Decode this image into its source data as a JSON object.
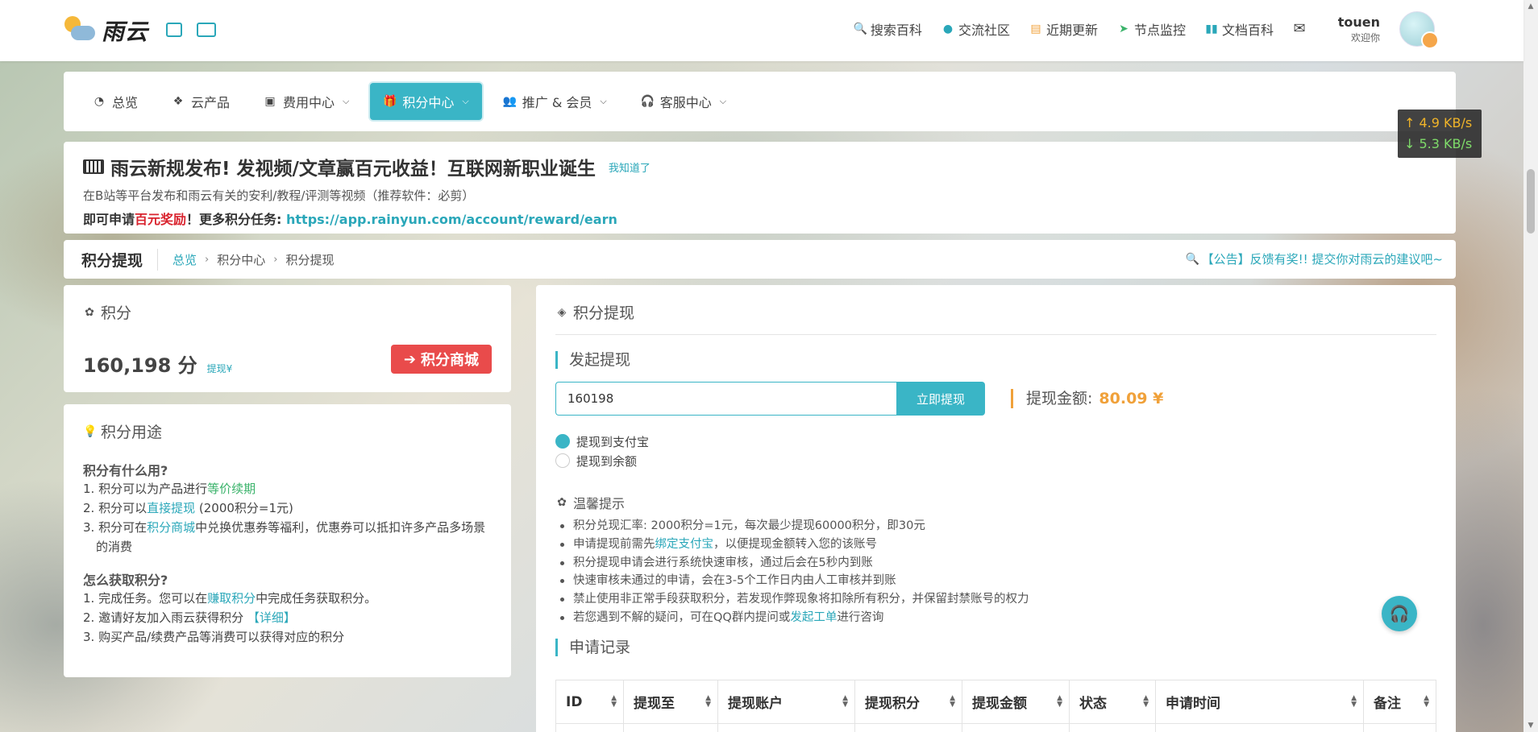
{
  "brand": {
    "name": "雨云"
  },
  "topnav": {
    "items": [
      {
        "icon": "search-icon",
        "label": "搜索百科"
      },
      {
        "icon": "bell-icon",
        "label": "交流社区"
      },
      {
        "icon": "news-icon",
        "label": "近期更新"
      },
      {
        "icon": "send-icon",
        "label": "节点监控"
      },
      {
        "icon": "book-icon",
        "label": "文档百科"
      }
    ],
    "user": {
      "name": "touen",
      "welcome": "欢迎你"
    }
  },
  "menu": {
    "items": [
      {
        "icon": "dashboard-icon",
        "label": "总览",
        "dropdown": false
      },
      {
        "icon": "cubes-icon",
        "label": "云产品",
        "dropdown": false
      },
      {
        "icon": "money-icon",
        "label": "费用中心",
        "dropdown": true
      },
      {
        "icon": "gift-icon",
        "label": "积分中心",
        "dropdown": true,
        "active": true
      },
      {
        "icon": "users-icon",
        "label": "推广 & 会员",
        "dropdown": true
      },
      {
        "icon": "headset-icon",
        "label": "客服中心",
        "dropdown": true
      }
    ]
  },
  "netspeed": {
    "up": "↑ 4.9 KB/s",
    "down": "↓ 5.3 KB/s"
  },
  "announcement": {
    "title": "雨云新规发布! 发视频/文章赢百元收益！互联网新职业诞生",
    "dismiss": "我知道了",
    "line1": "在B站等平台发布和雨云有关的安利/教程/评测等视频（推荐软件：必剪）",
    "line2_prefix": "即可申请",
    "line2_red": "百元奖励",
    "line2_mid": "！更多积分任务: ",
    "line2_link": "https://app.rainyun.com/account/reward/earn"
  },
  "breadcrumb": {
    "title": "积分提现",
    "items": [
      "总览",
      "积分中心",
      "积分提现"
    ],
    "notice": "【公告】反馈有奖!! 提交你对雨云的建议吧~"
  },
  "points": {
    "head": "积分",
    "value": "160,198 分",
    "sub": "提现¥",
    "shop_button": "积分商城"
  },
  "usage": {
    "head": "积分用途",
    "q1": "积分有什么用?",
    "a1": [
      {
        "pre": "1. 积分可以为产品进行",
        "hl": "等价续期",
        "post": ""
      },
      {
        "pre": "2. 积分可以",
        "hl": "直接提现",
        "post": " (2000积分=1元)"
      },
      {
        "pre": "3. 积分可在",
        "hl": "积分商城",
        "post": "中兑换优惠券等福利，优惠券可以抵扣许多产品多场景的消费"
      }
    ],
    "q2": "怎么获取积分?",
    "a2": [
      {
        "pre": "1. 完成任务。您可以在",
        "hl": "赚取积分",
        "post": "中完成任务获取积分。"
      },
      {
        "pre": "2. 邀请好友加入雨云获得积分 ",
        "hl": "【详细】",
        "post": ""
      },
      {
        "pre": "3. 购买产品/续费产品等消费可以获得对应的积分",
        "hl": "",
        "post": ""
      }
    ]
  },
  "withdraw": {
    "head": "积分提现",
    "section": "发起提现",
    "input_value": "160198",
    "button": "立即提现",
    "amount_label": "提现金额:",
    "amount_value": "80.09 ¥",
    "options": [
      "提现到支付宝",
      "提现到余额"
    ],
    "selected_option": 0,
    "tips_head": "温馨提示",
    "tips": [
      {
        "pre": "积分兑现汇率: 2000积分=1元，每次最少提现60000积分，即30元",
        "hl": "",
        "post": ""
      },
      {
        "pre": "申请提现前需先",
        "hl": "绑定支付宝",
        "post": "，以便提现金额转入您的该账号"
      },
      {
        "pre": "积分提现申请会进行系统快速审核，通过后会在5秒内到账",
        "hl": "",
        "post": ""
      },
      {
        "pre": "快速审核未通过的申请，会在3-5个工作日内由人工审核并到账",
        "hl": "",
        "post": ""
      },
      {
        "pre": "禁止使用非正常手段获取积分，若发现作弊现象将扣除所有积分，并保留封禁账号的权力",
        "hl": "",
        "post": ""
      },
      {
        "pre": "若您遇到不解的疑问，可在QQ群内提问或",
        "hl": "发起工单",
        "post": "进行咨询"
      }
    ],
    "records_title": "申请记录",
    "columns": [
      "ID",
      "提现至",
      "提现账户",
      "提现积分",
      "提现金额",
      "状态",
      "申请时间",
      "备注"
    ]
  },
  "colors": {
    "accent": "#3ab5c6",
    "danger": "#e94b4b",
    "amount": "#f0a13a"
  }
}
